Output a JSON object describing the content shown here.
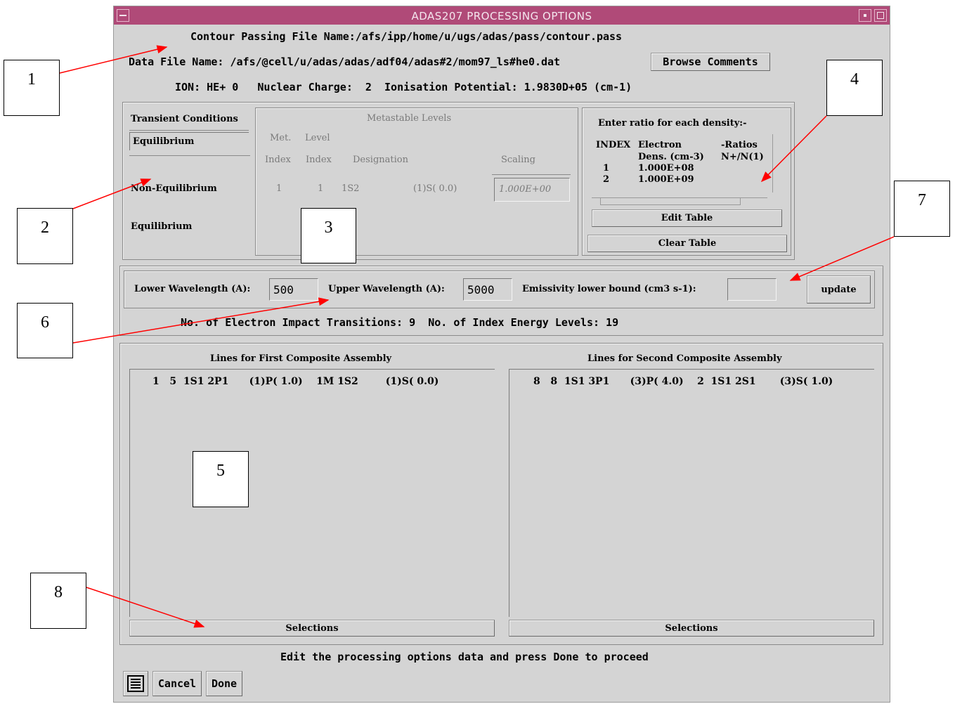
{
  "window": {
    "title": "ADAS207 PROCESSING OPTIONS",
    "contour_line": "Contour Passing File Name:/afs/ipp/home/u/ugs/adas/pass/contour.pass",
    "data_file_line": "Data File Name: /afs/@cell/u/adas/adas/adf04/adas#2/mom97_ls#he0.dat",
    "browse_label": "Browse Comments",
    "ion_line": "ION: HE+ 0   Nuclear Charge:  2  Ionisation Potential: 1.9830D+05 (cm-1)"
  },
  "transient": {
    "header": "Transient Conditions",
    "selected": "Equilibrium",
    "options": [
      "Non-Equilibrium",
      "Equilibrium"
    ]
  },
  "metastable": {
    "title": "Metastable Levels",
    "col_met": "Met.",
    "col_level": "Level",
    "col_index1": "Index",
    "col_index2": "Index",
    "col_designation": "Designation",
    "col_scaling": "Scaling",
    "row": {
      "met": "1",
      "level": "1",
      "config": "1S2",
      "term": "(1)S( 0.0)",
      "scaling": "1.000E+00"
    }
  },
  "ratio": {
    "header": "Enter ratio for each density:-",
    "col_index": "INDEX",
    "col_electron": "Electron",
    "col_dens": "Dens. (cm-3)",
    "col_ratios": "-Ratios",
    "col_nn": "N+/N(1)",
    "rows": [
      {
        "index": "1",
        "dens": "1.000E+08"
      },
      {
        "index": "2",
        "dens": "1.000E+09"
      }
    ],
    "edit_label": "Edit Table",
    "clear_label": "Clear Table"
  },
  "wavelength": {
    "lower_label": "Lower Wavelength (A):",
    "lower_value": "500",
    "upper_label": "Upper Wavelength (A):",
    "upper_value": "5000",
    "emiss_label": "Emissivity lower bound (cm3 s-1):",
    "emiss_value": "",
    "update_label": "update"
  },
  "counts_line": "No. of Electron Impact Transitions: 9  No. of Index Energy Levels: 19",
  "first_assembly": {
    "title": "Lines for First Composite Assembly",
    "line": "1   5  1S1 2P1      (1)P( 1.0)    1M 1S2        (1)S( 0.0)",
    "selections_label": "Selections"
  },
  "second_assembly": {
    "title": "Lines for Second Composite Assembly",
    "line": "8   8  1S1 3P1      (3)P( 4.0)    2  1S1 2S1       (3)S( 1.0)",
    "selections_label": "Selections"
  },
  "status_line": "Edit the processing options data and press Done to proceed",
  "footer": {
    "cancel_label": "Cancel",
    "done_label": "Done",
    "menu_icon": "menu-icon"
  },
  "callouts": [
    "1",
    "2",
    "3",
    "4",
    "5",
    "6",
    "7",
    "8"
  ],
  "colors": {
    "titlebar": "#b04a78",
    "window_bg": "#d4d4d4",
    "arrow": "#ff0000"
  }
}
